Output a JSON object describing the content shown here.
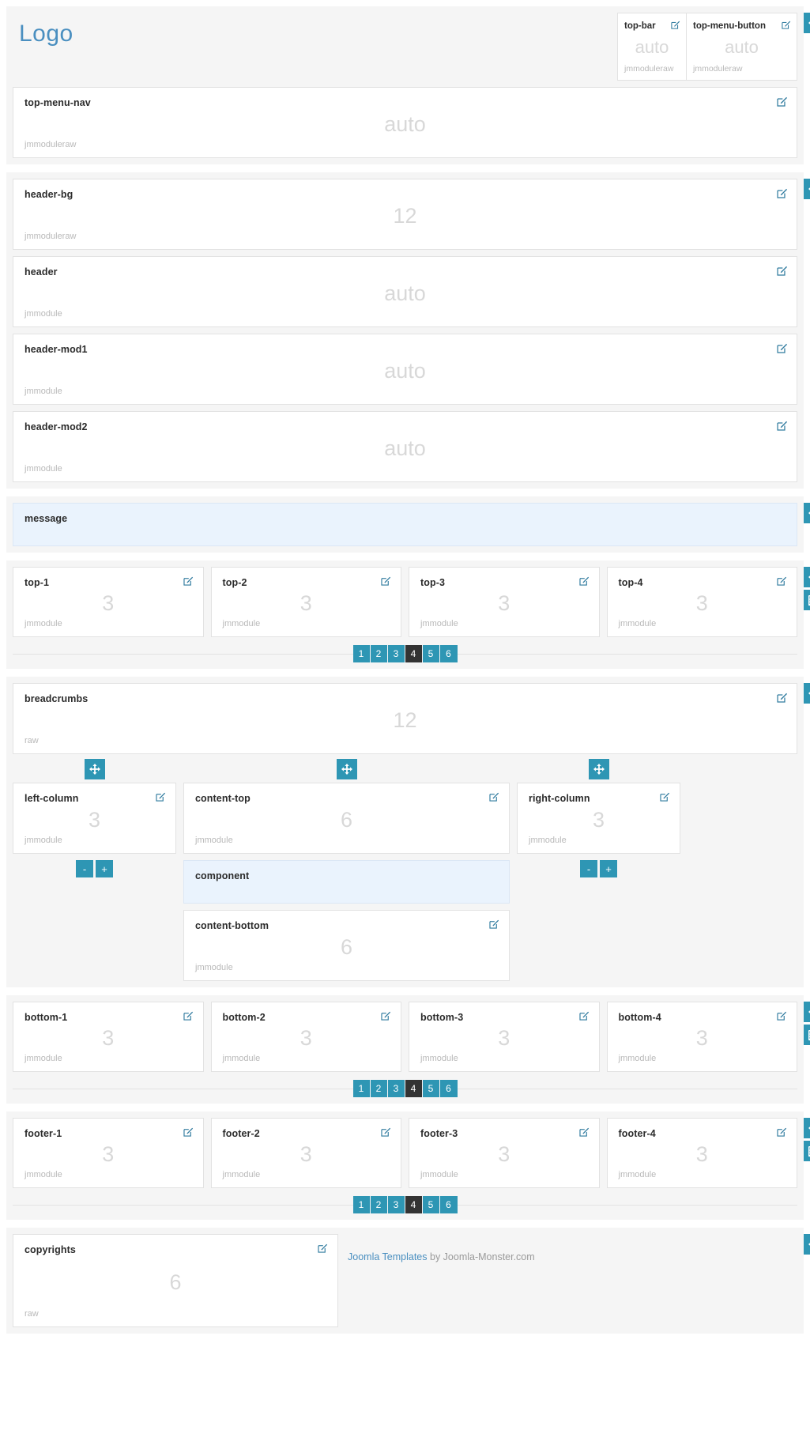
{
  "logo": {
    "text": "Logo"
  },
  "colors": {
    "teal": "#2e96b4",
    "active_dark": "#333333",
    "logo_blue": "#4a8fc0",
    "info_bg": "#eaf3fd"
  },
  "top_small_blocks": [
    {
      "title": "top-bar",
      "size": "auto",
      "kind": "jmmoduleraw"
    },
    {
      "title": "top-menu-button",
      "size": "auto",
      "kind": "jmmoduleraw"
    }
  ],
  "top_menu_nav": {
    "title": "top-menu-nav",
    "size": "auto",
    "kind": "jmmoduleraw"
  },
  "header_blocks": [
    {
      "title": "header-bg",
      "size": "12",
      "kind": "jmmoduleraw"
    },
    {
      "title": "header",
      "size": "auto",
      "kind": "jmmodule"
    },
    {
      "title": "header-mod1",
      "size": "auto",
      "kind": "jmmodule"
    },
    {
      "title": "header-mod2",
      "size": "auto",
      "kind": "jmmodule"
    }
  ],
  "message": {
    "title": "message"
  },
  "top_row": [
    {
      "title": "top-1",
      "size": "3",
      "kind": "jmmodule"
    },
    {
      "title": "top-2",
      "size": "3",
      "kind": "jmmodule"
    },
    {
      "title": "top-3",
      "size": "3",
      "kind": "jmmodule"
    },
    {
      "title": "top-4",
      "size": "3",
      "kind": "jmmodule"
    }
  ],
  "pagination": {
    "items": [
      "1",
      "2",
      "3",
      "4",
      "5",
      "6"
    ],
    "active": "4"
  },
  "breadcrumbs": {
    "title": "breadcrumbs",
    "size": "12",
    "kind": "raw"
  },
  "content": {
    "left": {
      "title": "left-column",
      "size": "3",
      "kind": "jmmodule"
    },
    "top": {
      "title": "content-top",
      "size": "6",
      "kind": "jmmodule"
    },
    "right": {
      "title": "right-column",
      "size": "3",
      "kind": "jmmodule"
    },
    "component": {
      "title": "component"
    },
    "bottom": {
      "title": "content-bottom",
      "size": "6",
      "kind": "jmmodule"
    },
    "minus_label": "-",
    "plus_label": "+"
  },
  "bottom_row": [
    {
      "title": "bottom-1",
      "size": "3",
      "kind": "jmmodule"
    },
    {
      "title": "bottom-2",
      "size": "3",
      "kind": "jmmodule"
    },
    {
      "title": "bottom-3",
      "size": "3",
      "kind": "jmmodule"
    },
    {
      "title": "bottom-4",
      "size": "3",
      "kind": "jmmodule"
    }
  ],
  "footer_row": [
    {
      "title": "footer-1",
      "size": "3",
      "kind": "jmmodule"
    },
    {
      "title": "footer-2",
      "size": "3",
      "kind": "jmmodule"
    },
    {
      "title": "footer-3",
      "size": "3",
      "kind": "jmmodule"
    },
    {
      "title": "footer-4",
      "size": "3",
      "kind": "jmmodule"
    }
  ],
  "copyrights": {
    "block": {
      "title": "copyrights",
      "size": "6",
      "kind": "raw"
    },
    "link_text": "Joomla Templates",
    "suffix_text": " by Joomla-Monster.com"
  },
  "icons": {
    "edit": "edit-pencil-icon",
    "move": "move-arrows-icon",
    "grid": "grid-layout-icon"
  }
}
